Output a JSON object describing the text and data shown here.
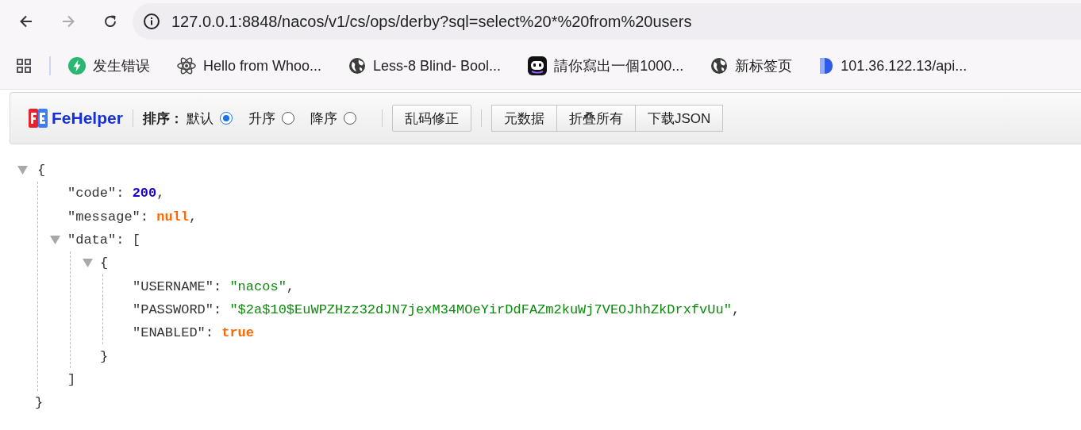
{
  "browser": {
    "address": "127.0.0.1:8848/nacos/v1/cs/ops/derby?sql=select%20*%20from%20users",
    "bookmarks": [
      {
        "kind": "bolt",
        "label": "发生错误"
      },
      {
        "kind": "atom",
        "label": "Hello from Whoo..."
      },
      {
        "kind": "globe",
        "label": "Less-8 Blind- Bool..."
      },
      {
        "kind": "robot",
        "label": "請你寫出一個1000..."
      },
      {
        "kind": "globe",
        "label": "新标签页"
      },
      {
        "kind": "logo",
        "label": "101.36.122.13/api..."
      }
    ]
  },
  "toolbar": {
    "brand": "FeHelper",
    "sort_label": "排序：",
    "sort_options": [
      {
        "label": "默认",
        "selected": true
      },
      {
        "label": "升序",
        "selected": false
      },
      {
        "label": "降序",
        "selected": false
      }
    ],
    "fix_button": "乱码修正",
    "buttons": [
      "元数据",
      "折叠所有",
      "下载JSON"
    ]
  },
  "json": {
    "kind": "object",
    "expanded": true,
    "open": "{",
    "close": "}",
    "children": [
      {
        "kind": "number",
        "key": "\"code\"",
        "colon": ": ",
        "value": "200",
        "comma": ","
      },
      {
        "kind": "null",
        "key": "\"message\"",
        "colon": ": ",
        "value": "null",
        "comma": ","
      },
      {
        "kind": "array",
        "key": "\"data\"",
        "colon": ": ",
        "expanded": true,
        "open": "[",
        "close": "]",
        "children": [
          {
            "kind": "object",
            "expanded": true,
            "open": "{",
            "close": "}",
            "children": [
              {
                "kind": "string",
                "key": "\"USERNAME\"",
                "colon": ": ",
                "value": "\"nacos\"",
                "comma": ","
              },
              {
                "kind": "string",
                "key": "\"PASSWORD\"",
                "colon": ": ",
                "value": "\"$2a$10$EuWPZHzz32dJN7jexM34MOeYirDdFAZm2kuWj7VEOJhhZkDrxfvUu\"",
                "comma": ","
              },
              {
                "kind": "boolean",
                "key": "\"ENABLED\"",
                "colon": ": ",
                "value": "true"
              }
            ]
          }
        ]
      }
    ]
  }
}
